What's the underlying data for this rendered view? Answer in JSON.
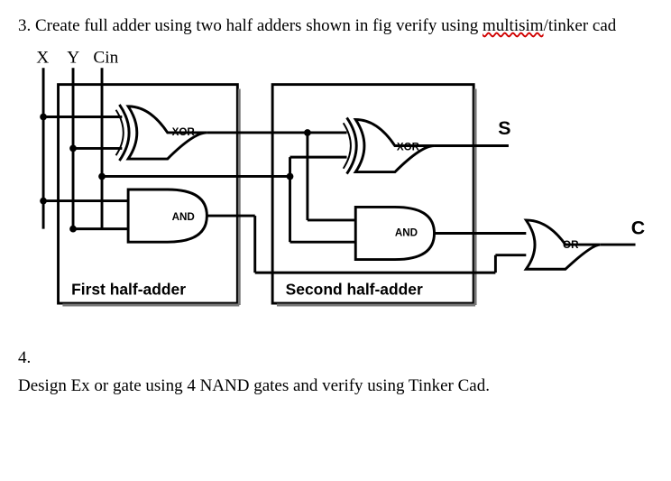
{
  "q3": {
    "number": "3.",
    "text_a": "Create full adder using two half adders shown in fig verify using ",
    "spell_word": "multisim",
    "text_b": "/tinker cad"
  },
  "q4": {
    "number": "4.",
    "text": "Design Ex or gate using 4 NAND gates and verify using Tinker Cad."
  },
  "diagram": {
    "inputs": {
      "x": "X",
      "y": "Y",
      "cin": "Cin"
    },
    "outputs": {
      "sum": "S",
      "carry": "C"
    },
    "gates": {
      "xor1": "XOR",
      "and1": "AND",
      "xor2": "XOR",
      "and2": "AND",
      "or": "OR"
    },
    "captions": {
      "first": "First half-adder",
      "second": "Second half-adder"
    }
  }
}
